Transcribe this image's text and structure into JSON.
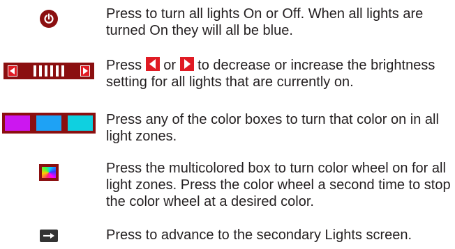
{
  "rows": [
    {
      "text": "Press to turn all lights On or Off. When all lights are turned On they will all be blue."
    },
    {
      "text_before": "Press ",
      "text_middle": " or ",
      "text_after": " to decrease or increase the brightness setting for all lights that are currently on."
    },
    {
      "text": "Press any of the color boxes to turn that color on in all light zones."
    },
    {
      "text": "Press the multicolored box to turn color wheel on for all light zones. Press the color wheel a second time to stop the color wheel at a desired color."
    },
    {
      "text": "Press to advance to the secondary Lights screen."
    }
  ],
  "icons": {
    "power": "power-icon",
    "brightness": "brightness-control",
    "decrease": "left-arrow-icon",
    "increase": "right-arrow-icon",
    "multicolor": "color-wheel-icon",
    "advance": "right-arrow-icon"
  },
  "colors": {
    "icon_bg": "#8b0f10",
    "arrow_red": "#e01b24",
    "swatches": [
      "#cc17f0",
      "#1ea2f5",
      "#0fd0e0"
    ]
  }
}
